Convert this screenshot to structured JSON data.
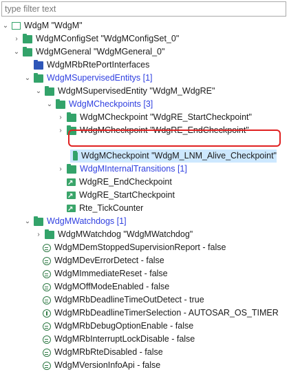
{
  "filter": {
    "placeholder": "type filter text"
  },
  "tree": {
    "root": "WdgM \"WdgM\"",
    "config_set": "WdgMConfigSet \"WdgMConfigSet_0\"",
    "general": "WdgMGeneral \"WdgMGeneral_0\"",
    "rte_port_interfaces": "WdgMRbRtePortInterfaces",
    "supervised_entitys": "WdgMSupervisedEntitys [1]",
    "supervised_entity": "WdgMSupervisedEntity \"WdgM_WdgRE\"",
    "checkpoints": "WdgMCheckpoints [3]",
    "checkpoint_start": "WdgMCheckpoint \"WdgRE_StartCheckpoint\"",
    "checkpoint_end": "WdgMCheckpoint \"WdgRE_EndCheckpoint\"",
    "checkpoint_lnm": "WdgMCheckpoint \"WdgM_LNM_Alive_Checkpoint\"",
    "internal_transitions": "WdgMInternalTransitions [1]",
    "ref_end": "WdgRE_EndCheckpoint",
    "ref_start": "WdgRE_StartCheckpoint",
    "ref_tick": "Rte_TickCounter",
    "watchdogs": "WdgMWatchdogs [1]",
    "watchdog": "WdgMWatchdog \"WdgMWatchdog\"",
    "params": [
      "WdgMDemStoppedSupervisionReport - false",
      "WdgMDevErrorDetect - false",
      "WdgMImmediateReset - false",
      "WdgMOffModeEnabled - false",
      "WdgMRbDeadlineTimeOutDetect - true",
      "WdgMRbDeadlineTimerSelection - AUTOSAR_OS_TIMER",
      "WdgMRbDebugOptionEnable - false",
      "WdgMRbInterruptLockDisable - false",
      "WdgMRbRteDisabled - false",
      "WdgMVersionInfoApi - false"
    ]
  },
  "icons": {
    "expanded": "chevron-down",
    "collapsed": "chevron-right",
    "folder_color": "#33a36a",
    "interface_folder_color": "#2e56b8",
    "highlight_color": "#e02020",
    "link_color": "#2f3fe0"
  }
}
